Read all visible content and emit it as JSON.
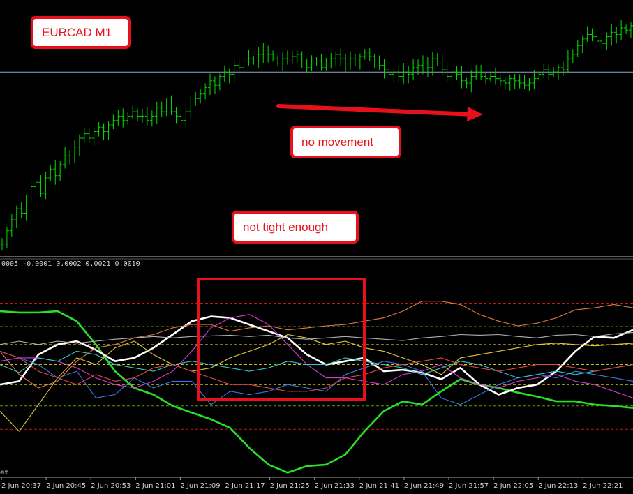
{
  "annotations": {
    "title": "EURCAD M1",
    "no_movement": "no movement",
    "not_tight": "not tight enough"
  },
  "indicator_values": "0005 -0.0001 0.0002 0.0021 0.0010",
  "watermark": "et",
  "colors": {
    "background": "#000000",
    "bars": "#00e000",
    "price_line": "#8fa8c8",
    "annotation_red": "#e8101a",
    "levels_red": "#c01818",
    "levels_green": "#5a9a10",
    "levels_yellow": "#c8c010"
  },
  "chart_data": [
    {
      "type": "ohlc",
      "symbol": "EURCAD",
      "timeframe": "M1",
      "price_line": 0.8,
      "description": "price series, normalized 0 (bottom of panel) to 1 (top of panel)",
      "close": [
        0.02,
        0.08,
        0.13,
        0.18,
        0.16,
        0.22,
        0.28,
        0.3,
        0.25,
        0.32,
        0.36,
        0.33,
        0.38,
        0.42,
        0.41,
        0.46,
        0.5,
        0.52,
        0.5,
        0.53,
        0.55,
        0.53,
        0.56,
        0.58,
        0.6,
        0.58,
        0.6,
        0.62,
        0.6,
        0.6,
        0.58,
        0.6,
        0.64,
        0.62,
        0.66,
        0.62,
        0.6,
        0.58,
        0.62,
        0.66,
        0.68,
        0.7,
        0.73,
        0.76,
        0.74,
        0.78,
        0.8,
        0.79,
        0.83,
        0.82,
        0.85,
        0.86,
        0.85,
        0.88,
        0.9,
        0.88,
        0.86,
        0.84,
        0.86,
        0.85,
        0.87,
        0.88,
        0.84,
        0.82,
        0.84,
        0.85,
        0.82,
        0.84,
        0.86,
        0.88,
        0.86,
        0.84,
        0.86,
        0.85,
        0.87,
        0.89,
        0.87,
        0.85,
        0.83,
        0.81,
        0.79,
        0.8,
        0.78,
        0.8,
        0.79,
        0.82,
        0.83,
        0.84,
        0.82,
        0.86,
        0.84,
        0.81,
        0.78,
        0.8,
        0.79,
        0.76,
        0.75,
        0.78,
        0.8,
        0.78,
        0.77,
        0.78,
        0.77,
        0.76,
        0.75,
        0.77,
        0.76,
        0.75,
        0.74,
        0.75,
        0.77,
        0.79,
        0.81,
        0.79,
        0.8,
        0.82,
        0.81,
        0.86,
        0.88,
        0.92,
        0.95,
        0.97,
        0.96,
        0.94,
        0.93,
        0.96,
        0.98,
        0.97,
        1.0,
        0.99,
        1.01
      ]
    },
    {
      "type": "line",
      "description": "oscillator panel, values normalized -1 (bottom) to 1 (top)",
      "x": [
        "2 Jun 20:37",
        "2 Jun 20:45",
        "2 Jun 20:53",
        "2 Jun 21:01",
        "2 Jun 21:09",
        "2 Jun 21:17",
        "2 Jun 21:25",
        "2 Jun 21:33",
        "2 Jun 21:41",
        "2 Jun 21:49",
        "2 Jun 21:57",
        "2 Jun 22:05",
        "2 Jun 22:13",
        "2 Jun 22:21"
      ],
      "levels": [
        {
          "value": 0.92,
          "color": "#c01818"
        },
        {
          "value": 0.57,
          "color": "#5a9a10"
        },
        {
          "value": 0.3,
          "color": "#c8c010"
        },
        {
          "value": 0.0,
          "color": "#c8c010"
        },
        {
          "value": -0.3,
          "color": "#c8c010"
        },
        {
          "value": -0.62,
          "color": "#5a9a10"
        },
        {
          "value": -0.97,
          "color": "#c01818"
        }
      ],
      "series": [
        {
          "color": "#28e028",
          "width": 2.6,
          "values": [
            0.8,
            0.78,
            0.78,
            0.8,
            0.65,
            0.3,
            -0.1,
            -0.35,
            -0.45,
            -0.62,
            -0.72,
            -0.82,
            -0.95,
            -1.25,
            -1.5,
            -1.62,
            -1.52,
            -1.5,
            -1.35,
            -1.0,
            -0.7,
            -0.55,
            -0.6,
            -0.4,
            -0.22,
            -0.3,
            -0.35,
            -0.42,
            -0.48,
            -0.55,
            -0.55,
            -0.6,
            -0.62,
            -0.65
          ]
        },
        {
          "color": "#ffffff",
          "width": 2.6,
          "values": [
            -0.3,
            -0.25,
            0.15,
            0.3,
            0.35,
            0.22,
            0.05,
            0.1,
            0.25,
            0.45,
            0.65,
            0.72,
            0.7,
            0.6,
            0.5,
            0.4,
            0.15,
            0.0,
            0.05,
            0.1,
            -0.1,
            -0.08,
            -0.12,
            -0.22,
            -0.05,
            -0.3,
            -0.45,
            -0.35,
            -0.3,
            -0.1,
            0.2,
            0.42,
            0.4,
            0.52
          ]
        },
        {
          "color": "#d838d8",
          "width": 1.1,
          "values": [
            0.05,
            0.1,
            0.1,
            0.05,
            -0.05,
            -0.2,
            -0.3,
            -0.35,
            -0.25,
            -0.1,
            0.2,
            0.55,
            0.7,
            0.75,
            0.6,
            0.3,
            0.0,
            -0.2,
            -0.2,
            -0.25,
            -0.3,
            -0.15,
            -0.1,
            0.0,
            -0.2,
            -0.3,
            -0.35,
            -0.25,
            -0.2,
            -0.15,
            -0.25,
            -0.3,
            -0.4,
            -0.5
          ]
        },
        {
          "color": "#3a78e8",
          "width": 1.1,
          "values": [
            0.2,
            0.1,
            0.0,
            -0.2,
            -0.1,
            -0.5,
            -0.45,
            -0.2,
            -0.35,
            -0.25,
            -0.25,
            -0.6,
            -0.4,
            -0.45,
            -0.4,
            -0.3,
            -0.35,
            -0.4,
            -0.15,
            -0.05,
            0.05,
            0.0,
            -0.1,
            -0.5,
            -0.6,
            -0.45,
            -0.3,
            -0.2,
            -0.15,
            -0.2,
            -0.1,
            -0.15,
            -0.2,
            -0.25
          ]
        },
        {
          "color": "#30c8c8",
          "width": 1.1,
          "values": [
            0.0,
            -0.12,
            0.1,
            0.05,
            0.2,
            0.15,
            0.0,
            -0.05,
            -0.1,
            0.0,
            0.05,
            0.0,
            -0.05,
            -0.1,
            -0.05,
            0.05,
            0.0,
            0.0,
            0.1,
            0.05,
            0.0,
            -0.05,
            -0.15,
            -0.05,
            0.05,
            0.0,
            -0.1,
            -0.2,
            -0.15,
            -0.1,
            -0.15,
            -0.1,
            -0.05,
            0.0
          ]
        },
        {
          "color": "#e0c840",
          "width": 1.1,
          "values": [
            -0.7,
            -1.0,
            -0.6,
            -0.2,
            0.1,
            0.0,
            0.25,
            0.35,
            0.15,
            0.0,
            -0.1,
            -0.05,
            0.1,
            0.2,
            0.3,
            0.45,
            0.4,
            0.3,
            0.35,
            0.25,
            0.2,
            0.1,
            0.0,
            -0.15,
            0.1,
            0.15,
            0.2,
            0.25,
            0.3,
            0.32,
            0.3,
            0.28,
            0.3,
            0.32
          ]
        },
        {
          "color": "#e07840",
          "width": 1.1,
          "values": [
            0.2,
            -0.15,
            -0.35,
            -0.25,
            0.05,
            0.25,
            0.3,
            0.4,
            0.45,
            0.55,
            0.6,
            0.6,
            0.5,
            0.55,
            0.58,
            0.52,
            0.55,
            0.58,
            0.6,
            0.65,
            0.7,
            0.8,
            0.95,
            0.95,
            0.9,
            0.75,
            0.65,
            0.58,
            0.62,
            0.7,
            0.82,
            0.85,
            0.9,
            0.85
          ]
        },
        {
          "color": "#e04848",
          "width": 1.1,
          "values": [
            0.2,
            0.1,
            -0.1,
            -0.2,
            -0.3,
            -0.15,
            -0.25,
            -0.2,
            -0.05,
            0.0,
            -0.1,
            -0.2,
            -0.3,
            -0.3,
            -0.35,
            -0.4,
            -0.4,
            -0.35,
            -0.2,
            -0.15,
            -0.05,
            0.0,
            0.05,
            0.1,
            0.0,
            -0.05,
            -0.1,
            -0.05,
            0.0,
            0.0,
            -0.05,
            -0.1,
            -0.05,
            0.0
          ]
        },
        {
          "color": "#b0b0b0",
          "width": 1.1,
          "values": [
            0.3,
            0.35,
            0.3,
            0.35,
            0.32,
            0.35,
            0.38,
            0.4,
            0.42,
            0.4,
            0.42,
            0.43,
            0.44,
            0.42,
            0.44,
            0.4,
            0.38,
            0.4,
            0.42,
            0.4,
            0.38,
            0.36,
            0.4,
            0.42,
            0.45,
            0.44,
            0.45,
            0.42,
            0.4,
            0.44,
            0.45,
            0.42,
            0.46,
            0.48
          ]
        }
      ]
    }
  ]
}
